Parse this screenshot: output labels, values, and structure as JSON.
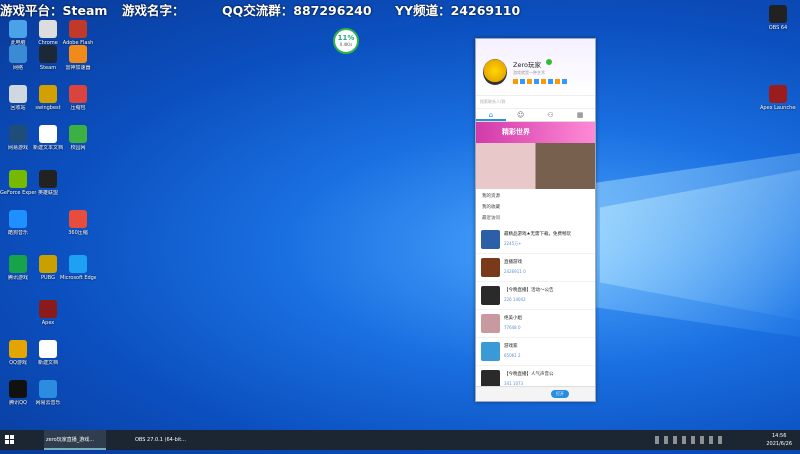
{
  "banner": {
    "platform": "游戏平台：Steam",
    "game": "游戏名字：",
    "qq": "QQ交流群：887296240",
    "yy": "YY频道：24269110"
  },
  "perf_widget": {
    "percent": "11%",
    "speed": "0.4K/s"
  },
  "desktop_icons": [
    {
      "label": "此电脑",
      "icon": "computer-icon",
      "color": "#4aa3e8"
    },
    {
      "label": "Chrome",
      "icon": "chrome-icon",
      "color": "#ddd"
    },
    {
      "label": "Adobe Flash",
      "icon": "flash-icon",
      "color": "#c0392b"
    },
    {
      "label": "网络",
      "icon": "network-icon",
      "color": "#3a8ad6"
    },
    {
      "label": "Steam",
      "icon": "steam-icon",
      "color": "#1b2838"
    },
    {
      "label": "雷神加速器",
      "icon": "accelerator-icon",
      "color": "#f08a1a"
    },
    {
      "label": "回收站",
      "icon": "recycle-bin-icon",
      "color": "#cfd8e0"
    },
    {
      "label": "swingbest",
      "icon": "game-icon",
      "color": "#d2a000"
    },
    {
      "label": "压缩包",
      "icon": "archive-icon",
      "color": "#d9443e"
    },
    {
      "label": "网易游戏",
      "icon": "launcher-icon",
      "color": "#1f4d7a"
    },
    {
      "label": "新建文本文档",
      "icon": "text-file-icon",
      "color": "#ffffff"
    },
    {
      "label": "校园网",
      "icon": "ie-icon",
      "color": "#3cb043"
    },
    {
      "label": "GeForce Experience",
      "icon": "nvidia-icon",
      "color": "#76b900"
    },
    {
      "label": "英雄联盟",
      "icon": "lol-icon",
      "color": "#222"
    },
    {
      "label": "酷狗音乐",
      "icon": "music-icon",
      "color": "#1e90ff"
    },
    {
      "label": "360压缩",
      "icon": "compress-icon",
      "color": "#e74c3c"
    },
    {
      "label": "腾讯游戏",
      "icon": "tencent-icon",
      "color": "#16a34a"
    },
    {
      "label": "Microsoft Edge",
      "icon": "edge-icon",
      "color": "#1da1f2"
    },
    {
      "label": "Apex",
      "icon": "apex-icon",
      "color": "#8b1a1a"
    },
    {
      "label": "PUBG",
      "icon": "pubg-icon",
      "color": "#c8a000"
    },
    {
      "label": "QQ游戏",
      "icon": "qq-game-icon",
      "color": "#e5a500"
    },
    {
      "label": "新建文档",
      "icon": "doc-icon",
      "color": "#fff"
    },
    {
      "label": "腾讯QQ",
      "icon": "qq-icon",
      "color": "#111"
    },
    {
      "label": "网易云音乐",
      "icon": "netease-icon",
      "color": "#2a8de0"
    },
    {
      "label": "OBS 64",
      "icon": "obs-icon",
      "color": "#222"
    },
    {
      "label": "Apex Launcher",
      "icon": "apex-launcher-icon",
      "color": "#9b1c1c"
    }
  ],
  "qq_window": {
    "name": "Zero玩家",
    "signature": "游戏就是一种艺术",
    "search_placeholder": "搜索联系人/群",
    "banner_title": "精彩世界",
    "groups": [
      "我的资源",
      "我的收藏",
      "最近访问"
    ],
    "items": [
      {
        "title": "最精品游戏★无需下载，免费畅玩",
        "meta": "2245万+",
        "color": "#2b5fa8"
      },
      {
        "title": "直播游戏",
        "meta": "2426911  0",
        "color": "#7a3a1a"
      },
      {
        "title": "【今晚直播】活动～公告",
        "meta": "226  14042",
        "color": "#2a2a2a"
      },
      {
        "title": "绝美小姐",
        "meta": "77648  0",
        "color": "#c89aa0"
      },
      {
        "title": "游戏家",
        "meta": "65061  2",
        "color": "#3a9ad6"
      },
      {
        "title": "【今晚直播】人气声音公",
        "meta": "341  1073",
        "color": "#2a2a2a"
      }
    ],
    "bottom_button": "打开"
  },
  "taskbar": {
    "items": [
      {
        "label": "zero玩家直播_游戏...",
        "active": true
      },
      {
        "label": "OBS 27.0.1 (64-bit...",
        "active": false
      }
    ],
    "time": "14:56",
    "date": "2021/6/26"
  }
}
